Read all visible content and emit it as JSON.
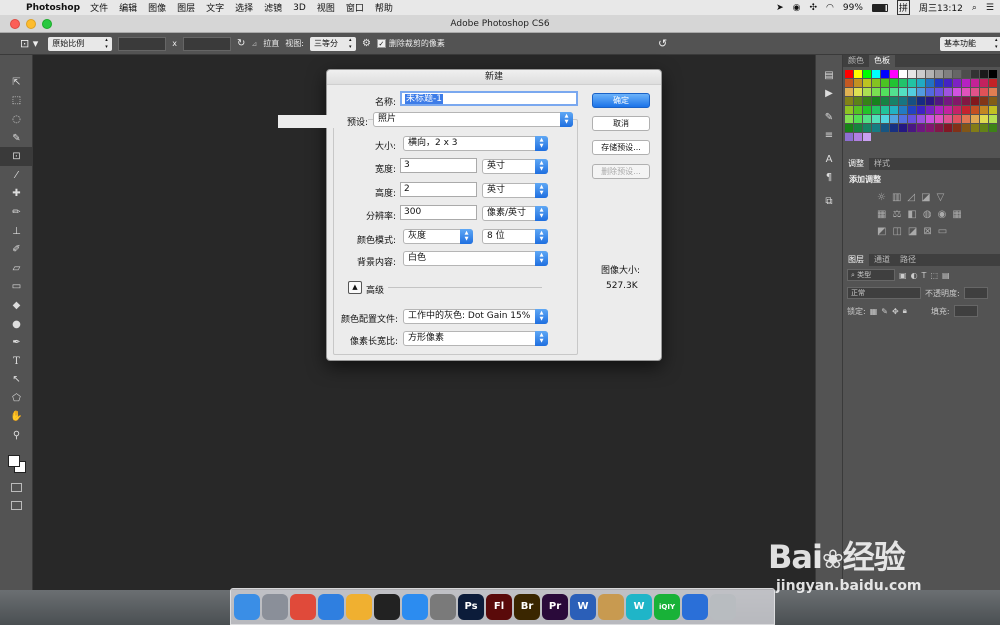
{
  "menubar": {
    "app": "Photoshop",
    "items": [
      "文件",
      "编辑",
      "图像",
      "图层",
      "文字",
      "选择",
      "滤镜",
      "3D",
      "视图",
      "窗口",
      "帮助"
    ],
    "battery": "99%",
    "input_method": "拼",
    "clock": "周三13:12"
  },
  "window": {
    "title": "Adobe Photoshop CS6"
  },
  "options": {
    "ratio": "原始比例",
    "x_sep": "x",
    "straighten": "拉直",
    "view_label": "视图:",
    "view_value": "三等分",
    "delete_cropped": "删除裁剪的像素",
    "workspace": "基本功能"
  },
  "panels": {
    "tabs_top": [
      "颜色",
      "色板"
    ],
    "tabs_mid": [
      "调整",
      "样式"
    ],
    "add_adjustment": "添加调整",
    "tabs_layers": [
      "图层",
      "通道",
      "路径"
    ],
    "kind": "类型",
    "blend": "正常",
    "opacity_label": "不透明度:",
    "lock_label": "锁定:",
    "fill_label": "填充:"
  },
  "dialog": {
    "title": "新建",
    "name_label": "名称:",
    "name_value": "未标题-1",
    "preset_label": "预设:",
    "preset_value": "照片",
    "size_label": "大小:",
    "size_value": "横向，2 x 3",
    "width_label": "宽度:",
    "width_value": "3",
    "width_unit": "英寸",
    "height_label": "高度:",
    "height_value": "2",
    "height_unit": "英寸",
    "resolution_label": "分辨率:",
    "resolution_value": "300",
    "resolution_unit": "像素/英寸",
    "colormode_label": "颜色模式:",
    "colormode_value": "灰度",
    "bitdepth_value": "8 位",
    "bg_label": "背景内容:",
    "bg_value": "白色",
    "advanced": "高级",
    "profile_label": "颜色配置文件:",
    "profile_value": "工作中的灰色: Dot Gain 15%",
    "aspect_label": "像素长宽比:",
    "aspect_value": "方形像素",
    "btn_ok": "确定",
    "btn_cancel": "取消",
    "btn_save_preset": "存储预设...",
    "btn_delete_preset": "删除预设...",
    "image_size_label": "图像大小:",
    "image_size_value": "527.3K"
  },
  "watermark": {
    "brand": "Bai",
    "brand2": "经验",
    "url": "jingyan.baidu.com"
  },
  "dock": {
    "apps": [
      {
        "icon": "finder-icon",
        "label": "",
        "color": "#3a8ee6"
      },
      {
        "icon": "launchpad-icon",
        "label": "",
        "color": "#8a8f99"
      },
      {
        "icon": "chrome-icon",
        "label": "",
        "color": "#e04a3a"
      },
      {
        "icon": "safari-icon",
        "label": "",
        "color": "#2f7fe0"
      },
      {
        "icon": "photos-icon",
        "label": "",
        "color": "#f0b030"
      },
      {
        "icon": "qq-icon",
        "label": "",
        "color": "#222222"
      },
      {
        "icon": "appstore-icon",
        "label": "",
        "color": "#2c8cf0"
      },
      {
        "icon": "settings-icon",
        "label": "",
        "color": "#7a7a7a"
      },
      {
        "icon": "photoshop-icon",
        "label": "Ps",
        "color": "#0c1c3a"
      },
      {
        "icon": "flash-icon",
        "label": "Fl",
        "color": "#5a0a0a"
      },
      {
        "icon": "bridge-icon",
        "label": "Br",
        "color": "#3a2600"
      },
      {
        "icon": "premiere-icon",
        "label": "Pr",
        "color": "#2a0a3a"
      },
      {
        "icon": "word-icon",
        "label": "W",
        "color": "#2b5fb8"
      },
      {
        "icon": "archive-icon",
        "label": "",
        "color": "#c89a50"
      },
      {
        "icon": "browser-w-icon",
        "label": "W",
        "color": "#1fb5c8"
      },
      {
        "icon": "iqiyi-icon",
        "label": "iQIY",
        "color": "#18b238"
      },
      {
        "icon": "quicktime-icon",
        "label": "",
        "color": "#2a6fd8"
      },
      {
        "icon": "trash-icon",
        "label": "",
        "color": "#b8bcc0"
      }
    ]
  },
  "colors": {
    "accent": "#1b73e8",
    "panel": "#535353",
    "canvas": "#282828"
  }
}
